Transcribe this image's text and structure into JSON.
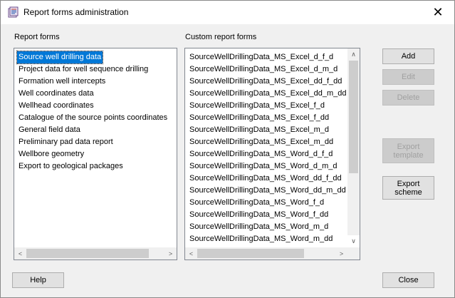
{
  "window": {
    "title": "Report forms administration"
  },
  "left": {
    "label": "Report forms",
    "items": [
      "Source well drilling data",
      "Project data for well sequence drilling",
      "Formation well intercepts",
      "Well coordinates data",
      "Wellhead coordinates",
      "Catalogue of the source points coordinates",
      "General field data",
      "Preliminary pad data report",
      "Wellbore geometry",
      "Export to geological packages"
    ]
  },
  "right": {
    "label": "Custom report forms",
    "items": [
      "SourceWellDrillingData_MS_Excel_d_f_d",
      "SourceWellDrillingData_MS_Excel_d_m_d",
      "SourceWellDrillingData_MS_Excel_dd_f_dd",
      "SourceWellDrillingData_MS_Excel_dd_m_dd",
      "SourceWellDrillingData_MS_Excel_f_d",
      "SourceWellDrillingData_MS_Excel_f_dd",
      "SourceWellDrillingData_MS_Excel_m_d",
      "SourceWellDrillingData_MS_Excel_m_dd",
      "SourceWellDrillingData_MS_Word_d_f_d",
      "SourceWellDrillingData_MS_Word_d_m_d",
      "SourceWellDrillingData_MS_Word_dd_f_dd",
      "SourceWellDrillingData_MS_Word_dd_m_dd",
      "SourceWellDrillingData_MS_Word_f_d",
      "SourceWellDrillingData_MS_Word_f_dd",
      "SourceWellDrillingData_MS_Word_m_d",
      "SourceWellDrillingData_MS_Word_m_dd"
    ]
  },
  "buttons": {
    "add": "Add",
    "edit": "Edit",
    "delete": "Delete",
    "export_template": "Export template",
    "export_scheme": "Export scheme",
    "help": "Help",
    "close": "Close"
  },
  "icons": {
    "close": "✕",
    "left_arrow": "<",
    "right_arrow": ">",
    "up_arrow": "∧",
    "down_arrow": "∨"
  }
}
